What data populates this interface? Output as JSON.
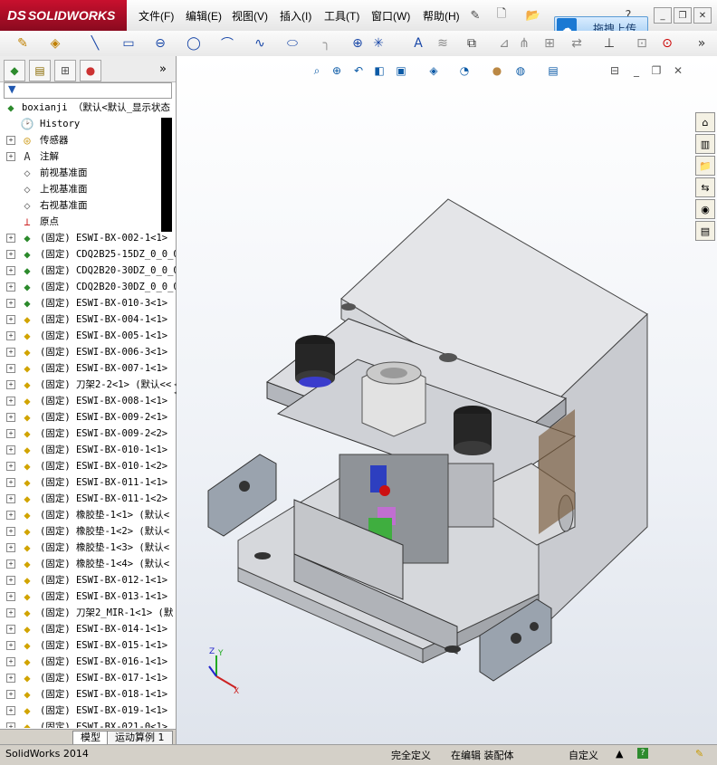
{
  "app": {
    "name": "SOLIDWORKS",
    "menus": [
      "文件(F)",
      "编辑(E)",
      "视图(V)",
      "插入(I)",
      "工具(T)",
      "窗口(W)",
      "帮助(H)"
    ],
    "upload_button": "拖拽上传"
  },
  "tree": {
    "root": "boxianji （默认<默认_显示状态",
    "items": [
      {
        "icon": "history-icon",
        "label": "History"
      },
      {
        "icon": "sensor-icon",
        "label": "传感器"
      },
      {
        "icon": "annotation-icon",
        "label": "注解"
      },
      {
        "icon": "plane-icon",
        "label": "前视基准面"
      },
      {
        "icon": "plane-icon",
        "label": "上视基准面"
      },
      {
        "icon": "plane-icon",
        "label": "右视基准面"
      },
      {
        "icon": "origin-icon",
        "label": "原点"
      },
      {
        "icon": "assembly-icon",
        "label": "(固定) ESWI-BX-002-1<1>"
      },
      {
        "icon": "assembly-icon",
        "label": "(固定) CDQ2B25-15DZ_0_0_0"
      },
      {
        "icon": "assembly-icon",
        "label": "(固定) CDQ2B20-30DZ_0_0_0"
      },
      {
        "icon": "assembly-icon",
        "label": "(固定) CDQ2B20-30DZ_0_0_0"
      },
      {
        "icon": "assembly-icon",
        "label": "(固定) ESWI-BX-010-3<1>"
      },
      {
        "icon": "part-icon",
        "label": "(固定) ESWI-BX-004-1<1>"
      },
      {
        "icon": "part-icon",
        "label": "(固定) ESWI-BX-005-1<1>"
      },
      {
        "icon": "part-icon",
        "label": "(固定) ESWI-BX-006-3<1>"
      },
      {
        "icon": "part-icon",
        "label": "(固定) ESWI-BX-007-1<1>"
      },
      {
        "icon": "part-icon",
        "label": "(固定) 刀架2-2<1> (默认<<"
      },
      {
        "icon": "part-icon",
        "label": "(固定) ESWI-BX-008-1<1>"
      },
      {
        "icon": "part-icon",
        "label": "(固定) ESWI-BX-009-2<1>"
      },
      {
        "icon": "part-icon",
        "label": "(固定) ESWI-BX-009-2<2>"
      },
      {
        "icon": "part-icon",
        "label": "(固定) ESWI-BX-010-1<1>"
      },
      {
        "icon": "part-icon",
        "label": "(固定) ESWI-BX-010-1<2>"
      },
      {
        "icon": "part-icon",
        "label": "(固定) ESWI-BX-011-1<1>"
      },
      {
        "icon": "part-icon",
        "label": "(固定) ESWI-BX-011-1<2>"
      },
      {
        "icon": "part-icon",
        "label": "(固定) 橡胶垫-1<1> (默认<"
      },
      {
        "icon": "part-icon",
        "label": "(固定) 橡胶垫-1<2> (默认<"
      },
      {
        "icon": "part-icon",
        "label": "(固定) 橡胶垫-1<3> (默认<"
      },
      {
        "icon": "part-icon",
        "label": "(固定) 橡胶垫-1<4> (默认<"
      },
      {
        "icon": "part-icon",
        "label": "(固定) ESWI-BX-012-1<1>"
      },
      {
        "icon": "part-icon",
        "label": "(固定) ESWI-BX-013-1<1>"
      },
      {
        "icon": "part-icon",
        "label": "(固定) 刀架2_MIR-1<1> (默"
      },
      {
        "icon": "part-icon",
        "label": "(固定) ESWI-BX-014-1<1>"
      },
      {
        "icon": "part-icon",
        "label": "(固定) ESWI-BX-015-1<1>"
      },
      {
        "icon": "part-icon",
        "label": "(固定) ESWI-BX-016-1<1>"
      },
      {
        "icon": "part-icon",
        "label": "(固定) ESWI-BX-017-1<1>"
      },
      {
        "icon": "part-icon",
        "label": "(固定) ESWI-BX-018-1<1>"
      },
      {
        "icon": "part-icon",
        "label": "(固定) ESWI-BX-019-1<1>"
      },
      {
        "icon": "part-icon",
        "label": "(固定) ESWI-BX-021-0<1>"
      }
    ]
  },
  "bottom_tabs": [
    "模型",
    "运动算例 1"
  ],
  "status": {
    "app_version": "SolidWorks 2014",
    "definition": "完全定义",
    "mode": "在编辑 装配体",
    "units": "自定义"
  },
  "triad": {
    "x": "X",
    "y": "Y",
    "z": "Z"
  }
}
